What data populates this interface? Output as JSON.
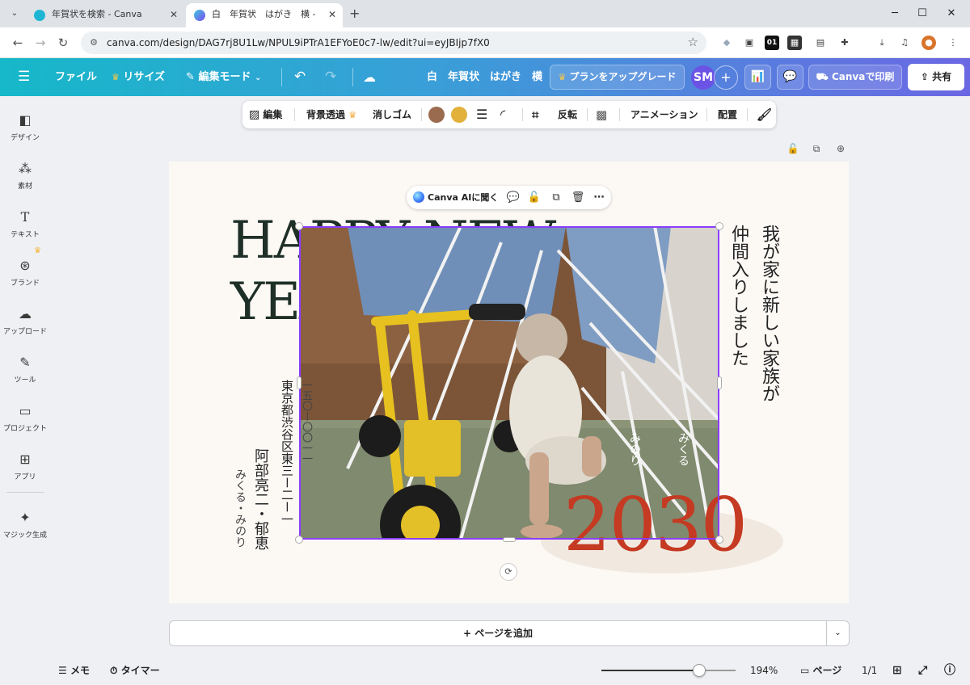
{
  "browser": {
    "tabs": [
      {
        "title": "年賀状を検索 - Canva",
        "active": false
      },
      {
        "title": "白　年賀状　はがき　横 - 年賀状",
        "active": true
      }
    ],
    "url": "canva.com/design/DAG7rj8U1Lw/NPUL9iPTrA1EFYoE0c7-lw/edit?ui=eyJBIjp7fX0"
  },
  "header": {
    "file": "ファイル",
    "resize": "リサイズ",
    "edit_mode": "編集モード",
    "doc_title": "白　年賀状　はがき　横",
    "upgrade": "プランをアップグレード",
    "avatar": "SM",
    "print": "Canvaで印刷",
    "share": "共有"
  },
  "sidebar": {
    "items": [
      {
        "label": "デザイン",
        "icon": "design-icon"
      },
      {
        "label": "素材",
        "icon": "elements-icon"
      },
      {
        "label": "テキスト",
        "icon": "text-icon"
      },
      {
        "label": "ブランド",
        "icon": "brand-icon"
      },
      {
        "label": "アップロード",
        "icon": "upload-icon"
      },
      {
        "label": "ツール",
        "icon": "tools-icon"
      },
      {
        "label": "プロジェクト",
        "icon": "projects-icon"
      },
      {
        "label": "アプリ",
        "icon": "apps-icon"
      },
      {
        "label": "マジック生成",
        "icon": "magic-icon"
      }
    ]
  },
  "toolbar": {
    "edit": "編集",
    "bg_remove": "背景透過",
    "eraser": "消しゴム",
    "flip": "反転",
    "animation": "アニメーション",
    "arrange": "配置",
    "colors": [
      "#9a6b4e",
      "#e2b13c"
    ]
  },
  "canvas": {
    "headline": "HAPPY NEW YEAR",
    "year": "2030",
    "message": [
      "我が家に新しい家族が",
      "仲間入りしました"
    ],
    "address": "東京都渋谷区東三ー二ー一",
    "postcode": "一五〇ー〇〇一一",
    "names": "阿部亮二・郁恵",
    "children": "みくる・みのり",
    "photo_name_1": "みくる",
    "photo_name_2": "みのり"
  },
  "floating": {
    "ai": "Canva AIに聞く"
  },
  "add_page": "+ ページを追加",
  "bottom": {
    "memo": "メモ",
    "timer": "タイマー",
    "zoom": "194%",
    "zoom_fraction": 0.73,
    "pages_label": "ページ",
    "page_count": "1/1"
  }
}
